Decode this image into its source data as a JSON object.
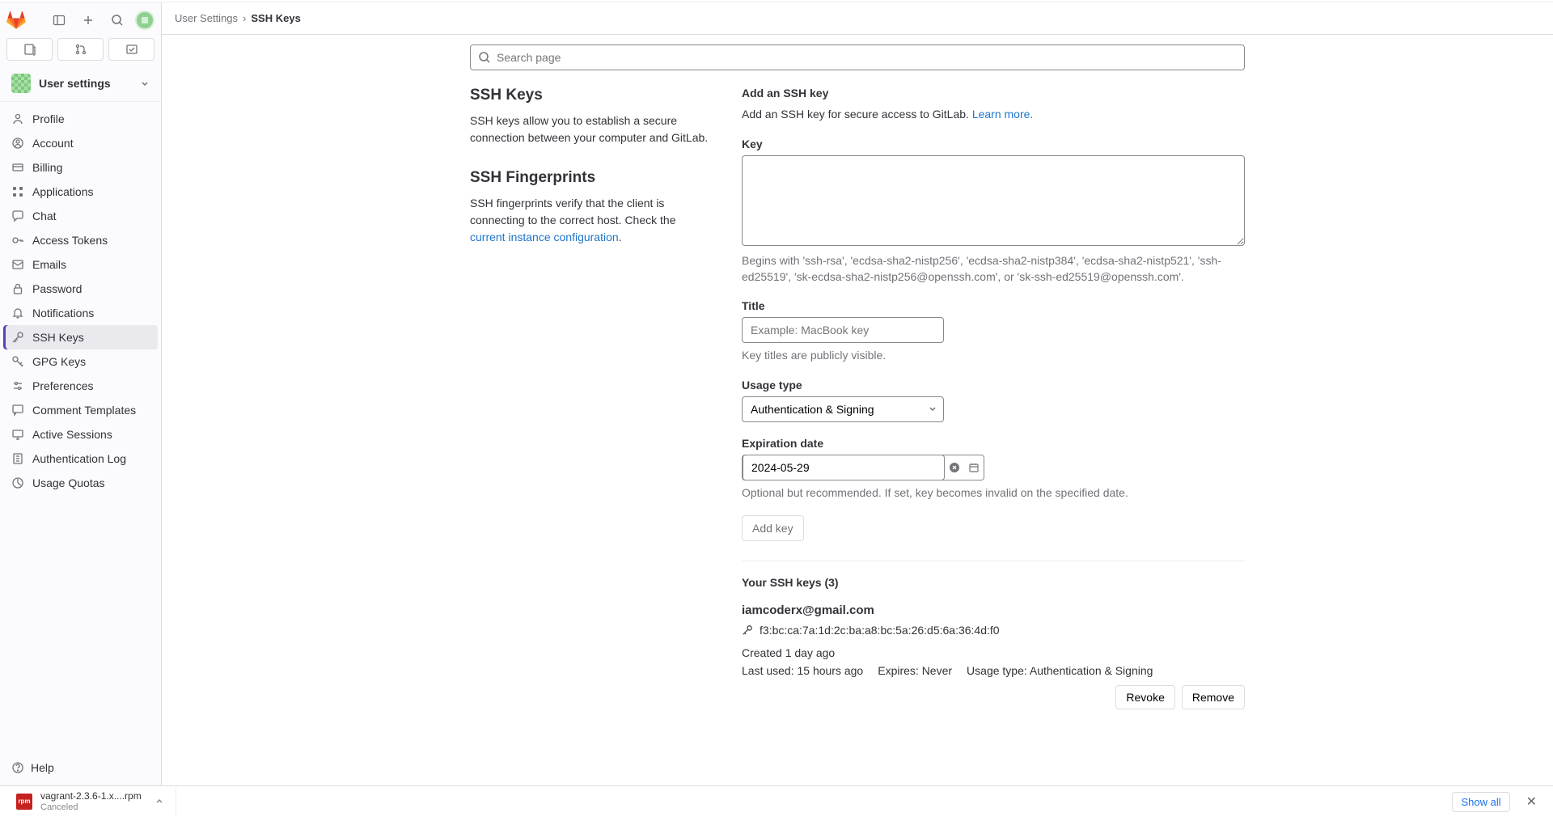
{
  "breadcrumb": {
    "parent": "User Settings",
    "current": "SSH Keys"
  },
  "sidebar": {
    "context_title": "User settings",
    "items": [
      {
        "label": "Profile"
      },
      {
        "label": "Account"
      },
      {
        "label": "Billing"
      },
      {
        "label": "Applications"
      },
      {
        "label": "Chat"
      },
      {
        "label": "Access Tokens"
      },
      {
        "label": "Emails"
      },
      {
        "label": "Password"
      },
      {
        "label": "Notifications"
      },
      {
        "label": "SSH Keys"
      },
      {
        "label": "GPG Keys"
      },
      {
        "label": "Preferences"
      },
      {
        "label": "Comment Templates"
      },
      {
        "label": "Active Sessions"
      },
      {
        "label": "Authentication Log"
      },
      {
        "label": "Usage Quotas"
      }
    ],
    "help": "Help"
  },
  "search": {
    "placeholder": "Search page"
  },
  "left": {
    "ssh_keys_title": "SSH Keys",
    "ssh_keys_desc": "SSH keys allow you to establish a secure connection between your computer and GitLab.",
    "fingerprints_title": "SSH Fingerprints",
    "fingerprints_desc_pre": "SSH fingerprints verify that the client is connecting to the correct host. Check the ",
    "fingerprints_link": "current instance configuration",
    "fingerprints_desc_post": "."
  },
  "form": {
    "heading": "Add an SSH key",
    "intro_pre": "Add an SSH key for secure access to GitLab. ",
    "learn_more": "Learn more.",
    "key_label": "Key",
    "key_help": "Begins with 'ssh-rsa', 'ecdsa-sha2-nistp256', 'ecdsa-sha2-nistp384', 'ecdsa-sha2-nistp521', 'ssh-ed25519', 'sk-ecdsa-sha2-nistp256@openssh.com', or 'sk-ssh-ed25519@openssh.com'.",
    "title_label": "Title",
    "title_placeholder": "Example: MacBook key",
    "title_help": "Key titles are publicly visible.",
    "usage_label": "Usage type",
    "usage_value": "Authentication & Signing",
    "exp_label": "Expiration date",
    "exp_value": "2024-05-29",
    "exp_help": "Optional but recommended. If set, key becomes invalid on the specified date.",
    "add_button": "Add key"
  },
  "keys": {
    "header": "Your SSH keys (3)",
    "entries": [
      {
        "title": "iamcoderx@gmail.com",
        "fingerprint": "f3:bc:ca:7a:1d:2c:ba:a8:bc:5a:26:d5:6a:36:4d:f0",
        "created": "Created 1 day ago",
        "last_used": "Last used: 15 hours ago",
        "expires": "Expires: Never",
        "usage": "Usage type: Authentication & Signing"
      }
    ],
    "revoke": "Revoke",
    "remove": "Remove"
  },
  "downloads": {
    "name": "vagrant-2.3.6-1.x....rpm",
    "status": "Canceled",
    "show_all": "Show all"
  }
}
